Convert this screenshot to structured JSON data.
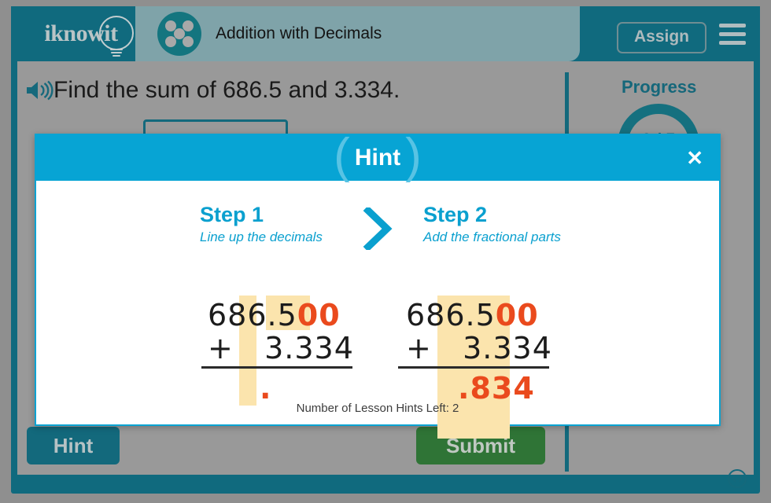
{
  "header": {
    "logo_text": "iknowit",
    "logo_icon": "lightbulb-icon",
    "lesson_icon": "five-dot-circle-icon",
    "lesson_title": "Addition with Decimals",
    "assign_label": "Assign",
    "menu_icon": "hamburger-menu-icon",
    "bg_color": "#106a7e",
    "title_bar_color": "#7fa3a9"
  },
  "question": {
    "speaker_icon": "speaker-audio-icon",
    "text": "Find the sum of 686.5 and 3.334.",
    "answer_value": "",
    "answer_placeholder": ""
  },
  "progress": {
    "label": "Progress",
    "ring_text": "0 / 5",
    "accent_color": "#15707f"
  },
  "footer": {
    "hint_label": "Hint",
    "submit_label": "Submit",
    "hint_color": "#13697c",
    "submit_color": "#2f7436",
    "resize_icon": "resize-horizontal-icon"
  },
  "modal": {
    "title": "Hint",
    "open_paren": "(",
    "close_paren": ")",
    "close_icon": "✕",
    "header_color": "#07a4d4",
    "hints_left": "Number of Lesson Hints Left: 2",
    "chevron_icon": "chevron-right-icon",
    "highlight_color": "#fbe4ad",
    "orange_color": "#ea4a1d",
    "steps": [
      {
        "title": "Step 1",
        "subtitle": "Line up the decimals",
        "addend1_whole": "686.5",
        "addend1_pad": "00",
        "plus": "+",
        "addend2": "3.334",
        "addend2_lead": "   ",
        "sum_partial": "."
      },
      {
        "title": "Step 2",
        "subtitle": "Add the fractional parts",
        "addend1_whole": "686.5",
        "addend1_pad": "00",
        "plus": "+",
        "addend2": "3.334",
        "addend2_lead": "   ",
        "sum_partial": ".834",
        "sum_dot": ".",
        "sum_digits": "834"
      }
    ]
  }
}
